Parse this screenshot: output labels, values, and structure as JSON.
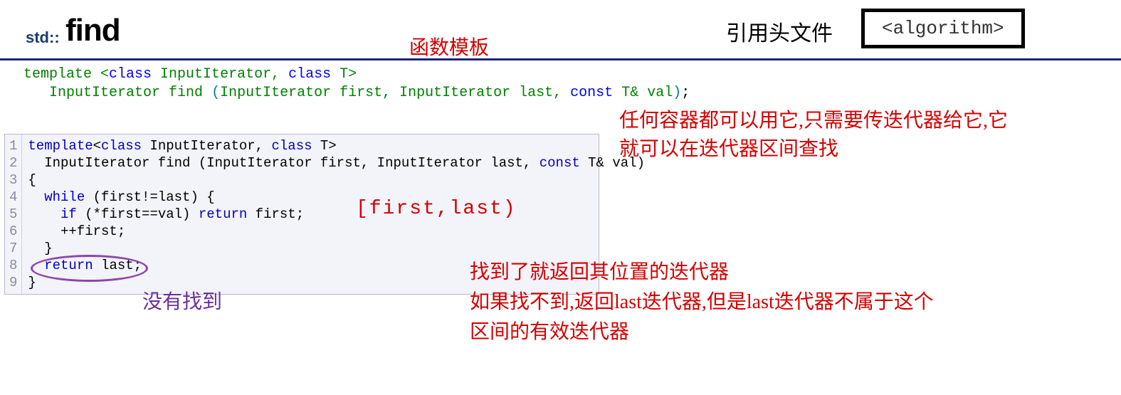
{
  "header": {
    "std_prefix": "std::",
    "function_name": "find",
    "subtitle": "函数模板",
    "include_label": "引用头文件",
    "include_header": "<algorithm>"
  },
  "signature": {
    "line1_template": "template",
    "line1_open": " <",
    "line1_class1": "class",
    "line1_type1": " InputIterator, ",
    "line1_class2": "class",
    "line1_type2": " T",
    "line1_close": ">",
    "line2_indent": "   ",
    "line2_ret": "InputIterator find ",
    "line2_paren_open": "(",
    "line2_params": "InputIterator first, InputIterator last, ",
    "line2_const": "const",
    "line2_rest": " T& val",
    "line2_paren_close": ")",
    "line2_semi": ";"
  },
  "annotations": {
    "right_top": "任何容器都可以用它,只需要传迭代器给它,它\n就可以在迭代器区间查找",
    "range": "[first,last)",
    "not_found": "没有找到",
    "bottom": "找到了就返回其位置的迭代器\n如果找不到,返回last迭代器,但是last迭代器不属于这个\n区间的有效迭代器"
  },
  "code": {
    "line_numbers": "1\n2\n3\n4\n5\n6\n7\n8\n9",
    "l1_template": "template",
    "l1_ab": "<",
    "l1_class": "class",
    "l1_rest1": " InputIterator, ",
    "l1_class2": "class",
    "l1_rest2": " T>",
    "l2": "  InputIterator find (InputIterator first, InputIterator last, ",
    "l2_const": "const",
    "l2_rest": " T& val)",
    "l3": "{",
    "l4_a": "  ",
    "l4_while": "while",
    "l4_b": " (first!=last) {",
    "l5_a": "    ",
    "l5_if": "if",
    "l5_b": " (*first==val) ",
    "l5_return": "return",
    "l5_c": " first;",
    "l6": "    ++first;",
    "l7": "  }",
    "l8_a": "  ",
    "l8_return": "return",
    "l8_b": " last;",
    "l9": "}"
  }
}
